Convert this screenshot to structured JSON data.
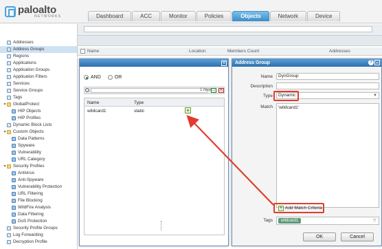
{
  "app": {
    "logo_name": "paloalto",
    "logo_sub": "NETWORKS",
    "accent": "#3d8cc9"
  },
  "tabs": [
    {
      "label": "Dashboard"
    },
    {
      "label": "ACC"
    },
    {
      "label": "Monitor"
    },
    {
      "label": "Policies"
    },
    {
      "label": "Objects",
      "active": true
    },
    {
      "label": "Network"
    },
    {
      "label": "Device"
    }
  ],
  "nav": [
    {
      "label": "Addresses",
      "depth": 0
    },
    {
      "label": "Address Groups",
      "depth": 0,
      "selected": true
    },
    {
      "label": "Regions",
      "depth": 0
    },
    {
      "label": "Applications",
      "depth": 0
    },
    {
      "label": "Application Groups",
      "depth": 0
    },
    {
      "label": "Application Filters",
      "depth": 0
    },
    {
      "label": "Services",
      "depth": 0
    },
    {
      "label": "Service Groups",
      "depth": 0
    },
    {
      "label": "Tags",
      "depth": 0
    },
    {
      "label": "GlobalProtect",
      "depth": 0,
      "expander": true
    },
    {
      "label": "HIP Objects",
      "depth": 1
    },
    {
      "label": "HIP Profiles",
      "depth": 1
    },
    {
      "label": "Dynamic Block Lists",
      "depth": 0
    },
    {
      "label": "Custom Objects",
      "depth": 0,
      "expander": true
    },
    {
      "label": "Data Patterns",
      "depth": 1
    },
    {
      "label": "Spyware",
      "depth": 1
    },
    {
      "label": "Vulnerability",
      "depth": 1
    },
    {
      "label": "URL Category",
      "depth": 1
    },
    {
      "label": "Security Profiles",
      "depth": 0,
      "expander": true
    },
    {
      "label": "Antivirus",
      "depth": 1
    },
    {
      "label": "Anti-Spyware",
      "depth": 1
    },
    {
      "label": "Vulnerability Protection",
      "depth": 1
    },
    {
      "label": "URL Filtering",
      "depth": 1
    },
    {
      "label": "File Blocking",
      "depth": 1
    },
    {
      "label": "WildFire Analysis",
      "depth": 1
    },
    {
      "label": "Data Filtering",
      "depth": 1
    },
    {
      "label": "DoS Protection",
      "depth": 1
    },
    {
      "label": "Security Profile Groups",
      "depth": 0
    },
    {
      "label": "Log Forwarding",
      "depth": 0
    },
    {
      "label": "Decryption Profile",
      "depth": 0
    }
  ],
  "object_table": {
    "col_name": "Name",
    "col_location": "Location",
    "col_members": "Members Count",
    "col_addresses": "Addresses"
  },
  "match_dialog": {
    "and_label": "AND",
    "or_label": "OR",
    "item_count": "1 item",
    "col_name": "Name",
    "col_type": "Type",
    "rows": [
      {
        "name": "wildcard1",
        "type": "static"
      }
    ]
  },
  "address_group": {
    "title": "Address Group",
    "name_label": "Name",
    "name_value": "DynGroup",
    "desc_label": "Description",
    "desc_value": "",
    "type_label": "Type",
    "type_value": "Dynamic",
    "match_label": "Match",
    "match_value": "'wildcard1'",
    "add_match_label": "Add Match Criteria",
    "tags_label": "Tags",
    "tag_value": "wildcard1",
    "ok_label": "OK",
    "cancel_label": "Cancel",
    "highlight_color": "#e23b2e"
  }
}
